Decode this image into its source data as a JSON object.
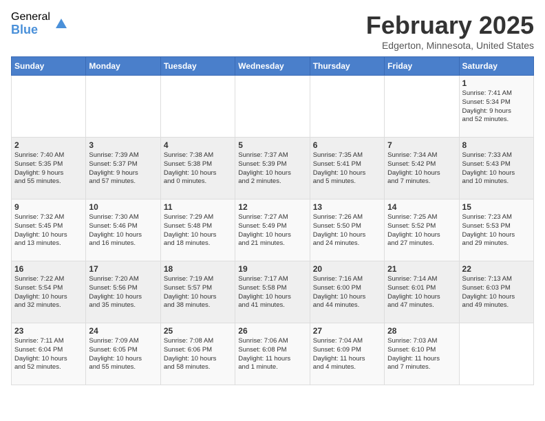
{
  "header": {
    "logo_general": "General",
    "logo_blue": "Blue",
    "month_title": "February 2025",
    "location": "Edgerton, Minnesota, United States"
  },
  "days_of_week": [
    "Sunday",
    "Monday",
    "Tuesday",
    "Wednesday",
    "Thursday",
    "Friday",
    "Saturday"
  ],
  "weeks": [
    [
      {
        "day": "",
        "info": ""
      },
      {
        "day": "",
        "info": ""
      },
      {
        "day": "",
        "info": ""
      },
      {
        "day": "",
        "info": ""
      },
      {
        "day": "",
        "info": ""
      },
      {
        "day": "",
        "info": ""
      },
      {
        "day": "1",
        "info": "Sunrise: 7:41 AM\nSunset: 5:34 PM\nDaylight: 9 hours\nand 52 minutes."
      }
    ],
    [
      {
        "day": "2",
        "info": "Sunrise: 7:40 AM\nSunset: 5:35 PM\nDaylight: 9 hours\nand 55 minutes."
      },
      {
        "day": "3",
        "info": "Sunrise: 7:39 AM\nSunset: 5:37 PM\nDaylight: 9 hours\nand 57 minutes."
      },
      {
        "day": "4",
        "info": "Sunrise: 7:38 AM\nSunset: 5:38 PM\nDaylight: 10 hours\nand 0 minutes."
      },
      {
        "day": "5",
        "info": "Sunrise: 7:37 AM\nSunset: 5:39 PM\nDaylight: 10 hours\nand 2 minutes."
      },
      {
        "day": "6",
        "info": "Sunrise: 7:35 AM\nSunset: 5:41 PM\nDaylight: 10 hours\nand 5 minutes."
      },
      {
        "day": "7",
        "info": "Sunrise: 7:34 AM\nSunset: 5:42 PM\nDaylight: 10 hours\nand 7 minutes."
      },
      {
        "day": "8",
        "info": "Sunrise: 7:33 AM\nSunset: 5:43 PM\nDaylight: 10 hours\nand 10 minutes."
      }
    ],
    [
      {
        "day": "9",
        "info": "Sunrise: 7:32 AM\nSunset: 5:45 PM\nDaylight: 10 hours\nand 13 minutes."
      },
      {
        "day": "10",
        "info": "Sunrise: 7:30 AM\nSunset: 5:46 PM\nDaylight: 10 hours\nand 16 minutes."
      },
      {
        "day": "11",
        "info": "Sunrise: 7:29 AM\nSunset: 5:48 PM\nDaylight: 10 hours\nand 18 minutes."
      },
      {
        "day": "12",
        "info": "Sunrise: 7:27 AM\nSunset: 5:49 PM\nDaylight: 10 hours\nand 21 minutes."
      },
      {
        "day": "13",
        "info": "Sunrise: 7:26 AM\nSunset: 5:50 PM\nDaylight: 10 hours\nand 24 minutes."
      },
      {
        "day": "14",
        "info": "Sunrise: 7:25 AM\nSunset: 5:52 PM\nDaylight: 10 hours\nand 27 minutes."
      },
      {
        "day": "15",
        "info": "Sunrise: 7:23 AM\nSunset: 5:53 PM\nDaylight: 10 hours\nand 29 minutes."
      }
    ],
    [
      {
        "day": "16",
        "info": "Sunrise: 7:22 AM\nSunset: 5:54 PM\nDaylight: 10 hours\nand 32 minutes."
      },
      {
        "day": "17",
        "info": "Sunrise: 7:20 AM\nSunset: 5:56 PM\nDaylight: 10 hours\nand 35 minutes."
      },
      {
        "day": "18",
        "info": "Sunrise: 7:19 AM\nSunset: 5:57 PM\nDaylight: 10 hours\nand 38 minutes."
      },
      {
        "day": "19",
        "info": "Sunrise: 7:17 AM\nSunset: 5:58 PM\nDaylight: 10 hours\nand 41 minutes."
      },
      {
        "day": "20",
        "info": "Sunrise: 7:16 AM\nSunset: 6:00 PM\nDaylight: 10 hours\nand 44 minutes."
      },
      {
        "day": "21",
        "info": "Sunrise: 7:14 AM\nSunset: 6:01 PM\nDaylight: 10 hours\nand 47 minutes."
      },
      {
        "day": "22",
        "info": "Sunrise: 7:13 AM\nSunset: 6:03 PM\nDaylight: 10 hours\nand 49 minutes."
      }
    ],
    [
      {
        "day": "23",
        "info": "Sunrise: 7:11 AM\nSunset: 6:04 PM\nDaylight: 10 hours\nand 52 minutes."
      },
      {
        "day": "24",
        "info": "Sunrise: 7:09 AM\nSunset: 6:05 PM\nDaylight: 10 hours\nand 55 minutes."
      },
      {
        "day": "25",
        "info": "Sunrise: 7:08 AM\nSunset: 6:06 PM\nDaylight: 10 hours\nand 58 minutes."
      },
      {
        "day": "26",
        "info": "Sunrise: 7:06 AM\nSunset: 6:08 PM\nDaylight: 11 hours\nand 1 minute."
      },
      {
        "day": "27",
        "info": "Sunrise: 7:04 AM\nSunset: 6:09 PM\nDaylight: 11 hours\nand 4 minutes."
      },
      {
        "day": "28",
        "info": "Sunrise: 7:03 AM\nSunset: 6:10 PM\nDaylight: 11 hours\nand 7 minutes."
      },
      {
        "day": "",
        "info": ""
      }
    ]
  ]
}
